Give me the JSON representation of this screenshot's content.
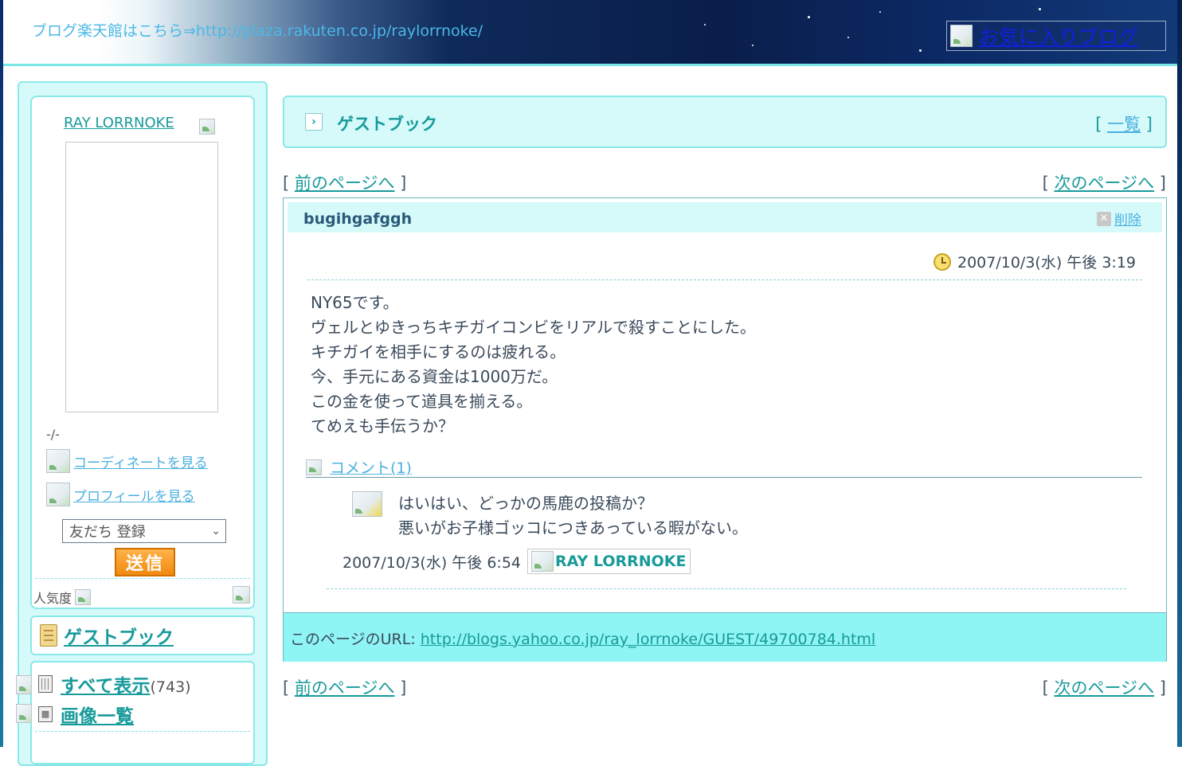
{
  "banner": {
    "text": "ブログ楽天館はこちら⇒http://plaza.rakuten.co.jp/raylorrnoke/",
    "favorite_label": "お気に入りブログ"
  },
  "profile": {
    "name": "RAY LORRNOKE",
    "date": "-/-",
    "coordinate_link": "コーディネートを見る",
    "profile_link": "プロフィールを見る",
    "friend_select": "友だち 登録",
    "send_button": "送信",
    "popularity_label": "人気度"
  },
  "sidebar": {
    "guestbook_link": "ゲストブック",
    "show_all": "すべて表示",
    "show_all_count": "(743)",
    "image_list": "画像一覧"
  },
  "guestbook_header": {
    "title": "ゲストブック",
    "list_bracket_open": "[",
    "list_link": "一覧",
    "list_bracket_close": "]"
  },
  "pager": {
    "prev": "前のページへ",
    "next": "次のページへ",
    "open": "[",
    "close": "]"
  },
  "entry": {
    "title": "bugihgafggh",
    "delete_label": "削除",
    "date": "2007/10/3(水) 午後 3:19",
    "body": [
      "NY65です。",
      "ヴェルとゆきっちキチガイコンビをリアルで殺すことにした。",
      "キチガイを相手にするのは疲れる。",
      "今、手元にある資金は1000万だ。",
      "この金を使って道具を揃える。",
      "てめえも手伝うか？"
    ],
    "comment_link": "コメント(1)"
  },
  "comment": {
    "lines": [
      "はいはい、どっかの馬鹿の投稿か？",
      "悪いがお子様ゴッコにつきあっている暇がない。"
    ],
    "date": "2007/10/3(水) 午後 6:54",
    "author": "RAY LORRNOKE"
  },
  "page_url": {
    "label": "このページのURL: ",
    "url": "http://blogs.yahoo.co.jp/ray_lorrnoke/GUEST/49700784.html"
  },
  "colors": {
    "accent": "#189a9a",
    "panel_bg": "#d6fafa",
    "panel_border": "#8ae8e8",
    "url_bar": "#8ef4f4",
    "send_button": "#f08a10"
  }
}
